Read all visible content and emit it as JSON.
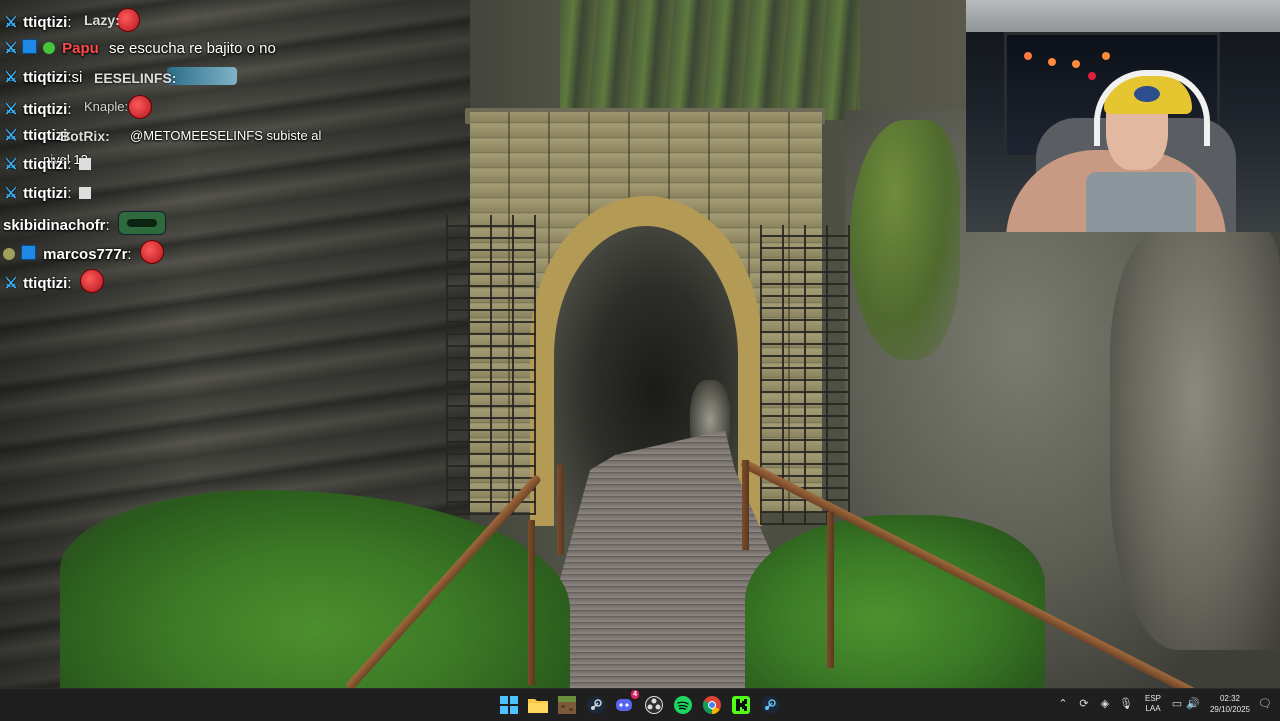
{
  "chat": {
    "messages": [
      {
        "user": "ttiqtizi",
        "sep": ":",
        "text": "",
        "emote": "red-emote"
      },
      {
        "user": "Papu",
        "sep": "",
        "text": "se escucha re bajito o no",
        "emote": ""
      },
      {
        "user": "ttiqtizi",
        "sep": ":",
        "text": "si",
        "emote": "teal-emote"
      },
      {
        "user": "ttiqtizi",
        "sep": ":",
        "text": "",
        "emote": "red-emote"
      },
      {
        "user": "ttiqtizi",
        "sep": ":",
        "text": "@METOMEESELINFS subiste al nivel 12",
        "emote": ""
      },
      {
        "user": "ttiqtizi",
        "sep": ":",
        "text": "",
        "emote": "small-emote"
      },
      {
        "user": "ttiqtizi",
        "sep": ":",
        "text": "",
        "emote": "small-emote"
      },
      {
        "user": "skibidinachofr",
        "sep": ":",
        "text": "",
        "emote": "green-emote"
      },
      {
        "user": "marcos777r",
        "sep": ":",
        "text": "",
        "emote": "red-emote"
      },
      {
        "user": "ttiqtizi",
        "sep": ":",
        "text": "",
        "emote": "red-emote"
      }
    ],
    "overlap": {
      "a": "Lazy:",
      "b": "EESELINFS:",
      "c": "Knaple:",
      "d": "BotRix:"
    }
  },
  "taskbar": {
    "apps": [
      "windows-start-icon",
      "file-explorer-icon",
      "minecraft-icon",
      "steam-icon",
      "discord-icon",
      "obs-icon",
      "spotify-icon",
      "chrome-icon",
      "kick-icon",
      "steam-icon-2"
    ],
    "discord_badge": "4",
    "language": "ESP",
    "keyboard_layout": "LAA",
    "time": "02:32",
    "date": "29/10/2025"
  },
  "colors": {
    "chat_text": "#ffffff",
    "badge_blue": "#38b6ff",
    "taskbar_bg": "#1f1f1f"
  }
}
